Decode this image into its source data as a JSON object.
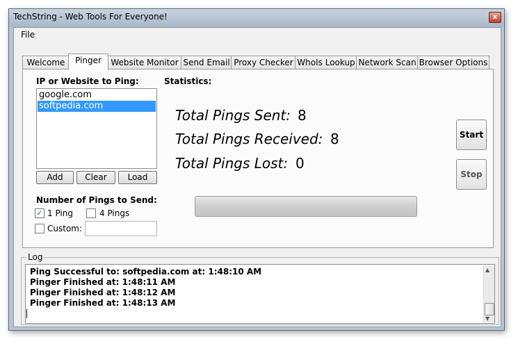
{
  "window": {
    "title": "TechString - Web Tools For Everyone!",
    "close_glyph": "x"
  },
  "menu": {
    "file": "File"
  },
  "tabs": [
    {
      "label": "Welcome"
    },
    {
      "label": "Pinger"
    },
    {
      "label": "Website Monitor"
    },
    {
      "label": "Send Email"
    },
    {
      "label": "Proxy Checker"
    },
    {
      "label": "WhoIs Lookup"
    },
    {
      "label": "Network Scan"
    },
    {
      "label": "Browser Options"
    }
  ],
  "pinger": {
    "ip_label": "IP or Website to Ping:",
    "hosts": [
      "google.com",
      "softpedia.com"
    ],
    "add": "Add",
    "clear": "Clear",
    "load": "Load",
    "count_label": "Number of Pings to Send:",
    "one_ping": "1 Ping",
    "four_pings": "4 Pings",
    "custom": "Custom:",
    "check_glyph": "✓",
    "statistics": "Statistics:",
    "sent_label": "Total Pings Sent:",
    "sent_value": "8",
    "received_label": "Total Pings Received:",
    "received_value": "8",
    "lost_label": "Total Pings Lost:",
    "lost_value": "0",
    "start": "Start",
    "stop": "Stop"
  },
  "log": {
    "label": "Log",
    "lines": [
      "Ping Successful to: softpedia.com at: 1:48:10 AM",
      "Pinger Finished at: 1:48:11 AM",
      "Pinger Finished at: 1:48:12 AM",
      "Pinger Finished at: 1:48:13 AM"
    ],
    "up_arrow": "▲",
    "down_arrow": "▼"
  }
}
